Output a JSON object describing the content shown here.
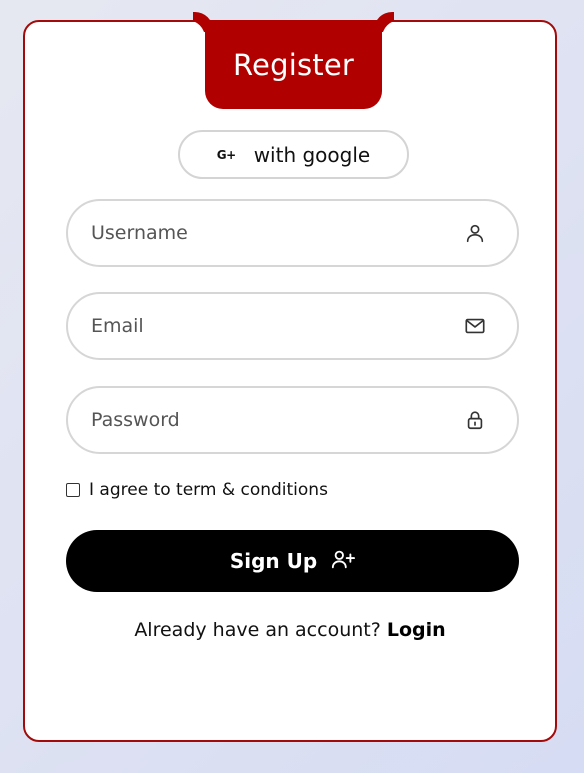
{
  "form": {
    "title": "Register",
    "google_button": {
      "icon_text": "G+",
      "label": "with google",
      "icon": "google-plus-icon"
    },
    "fields": {
      "username": {
        "placeholder": "Username",
        "value": "",
        "icon": "user-icon"
      },
      "email": {
        "placeholder": "Email",
        "value": "",
        "icon": "envelope-icon"
      },
      "password": {
        "placeholder": "Password",
        "value": "",
        "icon": "lock-icon"
      }
    },
    "agree": {
      "label": "I agree to term & conditions",
      "checked": false
    },
    "signup_button": {
      "label": "Sign Up",
      "icon": "add-user-icon"
    },
    "footer": {
      "prompt": "Already have an account?",
      "link": "Login"
    }
  },
  "colors": {
    "accent": "#b00000",
    "border": "#a30b0b",
    "button": "#000000"
  }
}
